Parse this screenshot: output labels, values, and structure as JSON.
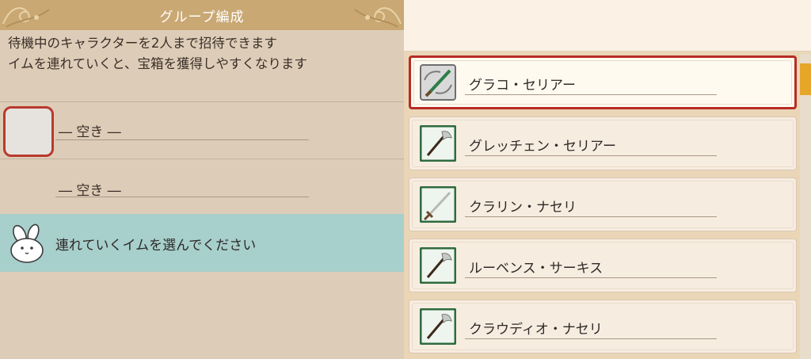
{
  "header": {
    "title": "グループ編成"
  },
  "description": {
    "line1": "待機中のキャラクターを2人まで招待できます",
    "line2": "イムを連れていくと、宝箱を獲得しやすくなります"
  },
  "slots": [
    {
      "label": "― 空き ―"
    },
    {
      "label": "― 空き ―"
    }
  ],
  "prompt": {
    "text": "連れていくイムを選んでください"
  },
  "characters": [
    {
      "name": "グラコ・セリアー",
      "weapon_icon": "sword-icon",
      "selected": true
    },
    {
      "name": "グレッチェン・セリアー",
      "weapon_icon": "axe-icon",
      "selected": false
    },
    {
      "name": "クラリン・ナセリ",
      "weapon_icon": "sword-icon",
      "selected": false
    },
    {
      "name": "ルーベンス・サーキス",
      "weapon_icon": "axe-icon",
      "selected": false
    },
    {
      "name": "クラウディオ・ナセリ",
      "weapon_icon": "axe-icon",
      "selected": false
    }
  ],
  "colors": {
    "header_bg": "#c9a874",
    "selection_border": "#b72c23",
    "prompt_bg": "#a7cfcc",
    "scroll_thumb": "#e6a62a"
  }
}
